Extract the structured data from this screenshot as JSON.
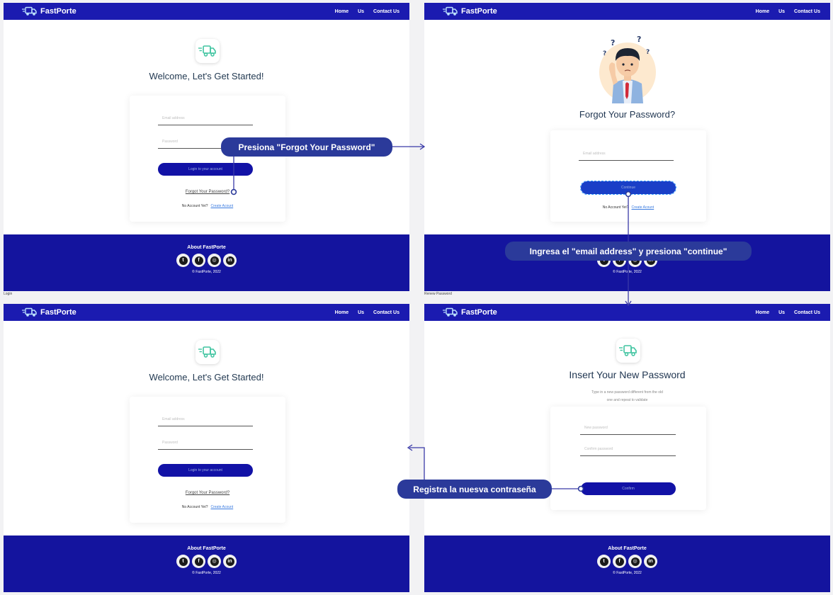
{
  "brand": {
    "name": "FastPorte"
  },
  "nav": {
    "home": "Home",
    "us": "Us",
    "contact": "Contact Us"
  },
  "footer": {
    "title": "About FastPorte",
    "copyright": "© FastPorte, 2022"
  },
  "socials": [
    {
      "icon": "twitter-icon",
      "glyph": "t"
    },
    {
      "icon": "facebook-icon",
      "glyph": "f"
    },
    {
      "icon": "instagram-icon",
      "glyph": "◎"
    },
    {
      "icon": "linkedin-icon",
      "glyph": "in"
    }
  ],
  "login": {
    "title": "Welcome, Let's Get Started!",
    "email_placeholder": "Email address",
    "password_placeholder": "Password",
    "login_button": "Login to your account",
    "forgot_link": "Forgot Your Password?",
    "no_account": "No Account Yet?",
    "create_account": "Create Acount",
    "caption": "Login"
  },
  "renew": {
    "title": "Forgot Your Password?",
    "email_placeholder": "Email address",
    "continue_button": "Continue",
    "no_account": "No Account Yet?",
    "create_account": "Create Acount",
    "caption": "Renew Password"
  },
  "newpass": {
    "title": "Insert Your New Password",
    "subtitle_line1": "Type in a new password different from the old",
    "subtitle_line2": "one and repeat to validate",
    "new_password_placeholder": "New password",
    "confirm_password_placeholder": "Confirm password",
    "confirm_button": "Confirm"
  },
  "callouts": {
    "step1": "Presiona \"Forgot Your Password\"",
    "step2": "Ingresa el \"email address\" y presiona \"continue\"",
    "step3": "Registra la nuesva contraseña"
  },
  "colors": {
    "nav": "#1b1bb0",
    "footer": "#14149e",
    "button": "#1212a6",
    "callout": "#2b3a9a",
    "connector": "#3a3aa8",
    "truck_icon": "#3fc4a0"
  }
}
